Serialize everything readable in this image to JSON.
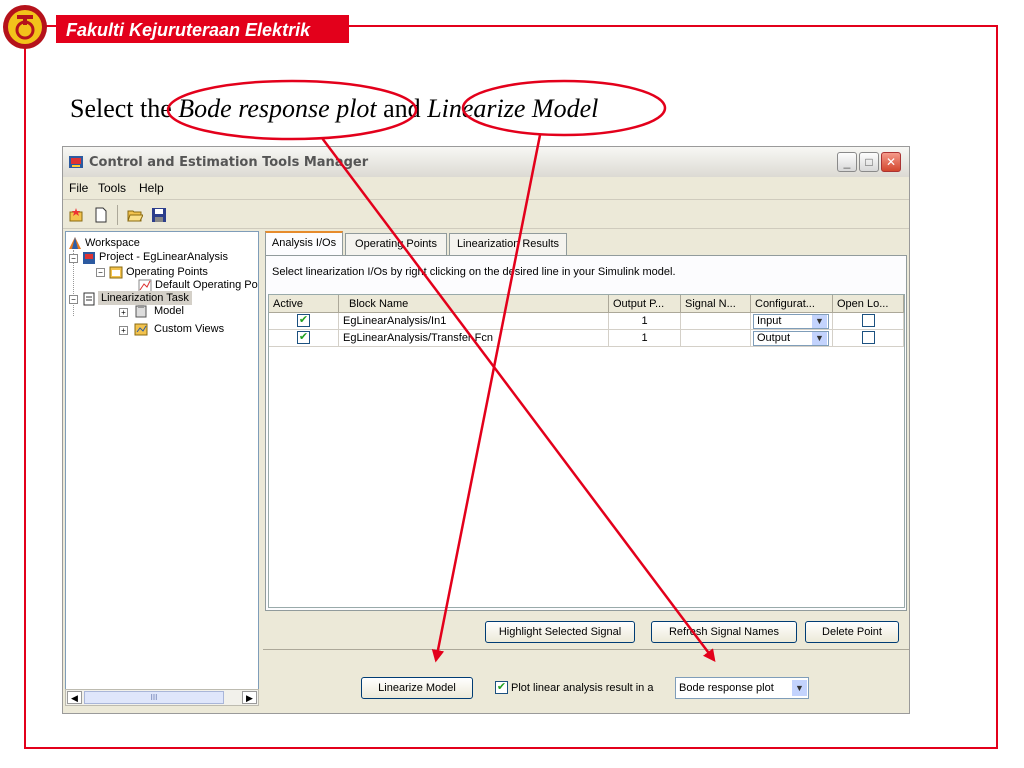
{
  "header": {
    "title": "Fakulti Kejuruteraan Elektrik"
  },
  "instruction": {
    "prefix": "Select the ",
    "plot_term": "Bode response plot",
    "middle": " and ",
    "model_term": "Linearize Model"
  },
  "window": {
    "title": "Control and Estimation Tools Manager",
    "menu": [
      "File",
      "Tools",
      "Help"
    ],
    "tree": {
      "workspace": "Workspace",
      "project": "Project - EgLinearAnalysis",
      "operating_points": "Operating Points",
      "default_operating_point": "Default Operating Po",
      "linearization_task": "Linearization Task",
      "model": "Model",
      "custom_views": "Custom Views",
      "scroll_thumb": "III"
    },
    "tabs": [
      "Analysis I/Os",
      "Operating Points",
      "Linearization Results"
    ],
    "description": "Select linearization I/Os by right clicking on the desired line in your Simulink model.",
    "columns": [
      "Active",
      "Block Name",
      "Output P...",
      "Signal N...",
      "Configurat...",
      "Open Lo..."
    ],
    "rows": [
      {
        "active": true,
        "block": "EgLinearAnalysis/In1",
        "output": "1",
        "signal": "",
        "config": "Input",
        "open_loop": false
      },
      {
        "active": true,
        "block": "EgLinearAnalysis/Transfer Fcn",
        "output": "1",
        "signal": "",
        "config": "Output",
        "open_loop": false
      }
    ],
    "buttons": {
      "highlight": "Highlight Selected Signal",
      "refresh": "Refresh Signal Names",
      "delete": "Delete Point",
      "linearize": "Linearize Model"
    },
    "plot_checkbox_label": "Plot linear analysis result in a",
    "plot_type": "Bode response plot"
  },
  "colors": {
    "accent_red": "#e3001b",
    "check_green": "#21a121"
  }
}
